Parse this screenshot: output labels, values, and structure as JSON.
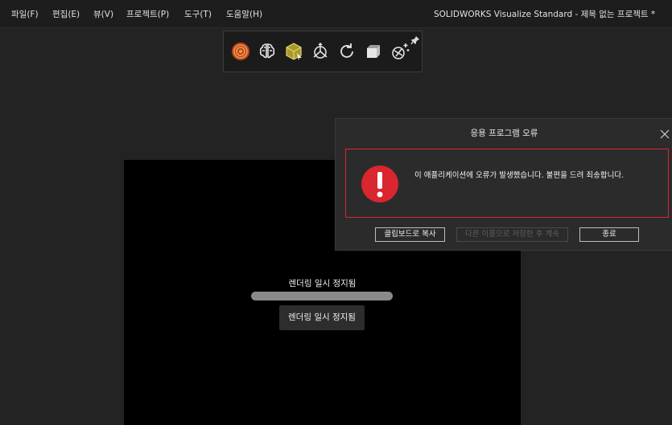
{
  "menubar": {
    "items": [
      {
        "label": "파일(F)"
      },
      {
        "label": "편집(E)"
      },
      {
        "label": "뷰(V)"
      },
      {
        "label": "프로젝트(P)"
      },
      {
        "label": "도구(T)"
      },
      {
        "label": "도움말(H)"
      }
    ],
    "window_title": "SOLIDWORKS Visualize Standard - 제목 없는 프로젝트 *"
  },
  "toolbar": {
    "icons": [
      "render-target-icon",
      "brain-icon",
      "cube-select-icon",
      "axis-gizmo-icon",
      "rotate-icon",
      "transform-object-icon",
      "scene-magic-icon"
    ],
    "pin_icon": "pin-icon"
  },
  "viewport": {
    "status_label": "렌더링 일시 정지됨",
    "button_label": "렌더링 일시 정지됨"
  },
  "dialog": {
    "title": "응용 프로그램 오류",
    "message": "이 애플리케이션에 오류가 발생했습니다. 불편을 드려 죄송합니다.",
    "buttons": {
      "copy": "클립보드로 복사",
      "save_continue": "다른 이름으로 저장한 후 계속",
      "exit": "종료"
    },
    "error_color": "#d9262f"
  }
}
